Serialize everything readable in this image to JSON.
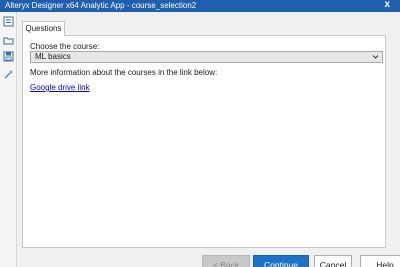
{
  "window": {
    "title": "Alteryx Designer x64 Analytic App - course_selection2",
    "close_glyph": "x"
  },
  "sidebar": {
    "icons": [
      "form-icon",
      "folder-icon",
      "save-icon",
      "magic-wand-icon"
    ]
  },
  "tabs": [
    {
      "label": "Questions",
      "active": true
    }
  ],
  "form": {
    "choose_label": "Choose the course:",
    "course_select": {
      "value": "ML basics"
    },
    "info_text": "More information about the courses in the link below:",
    "link_text": "Google drive link"
  },
  "buttons": {
    "back": {
      "label_prefix": "< ",
      "label_accel": "B",
      "label_rest": "ack",
      "enabled": false
    },
    "continue": {
      "label_accel": "C",
      "label_rest": "ontinue"
    },
    "cancel": "Cancel",
    "help": "Help"
  },
  "colors": {
    "titlebar": "#1f5fae",
    "primary_button": "#1e73c8",
    "link": "#0000ee"
  }
}
